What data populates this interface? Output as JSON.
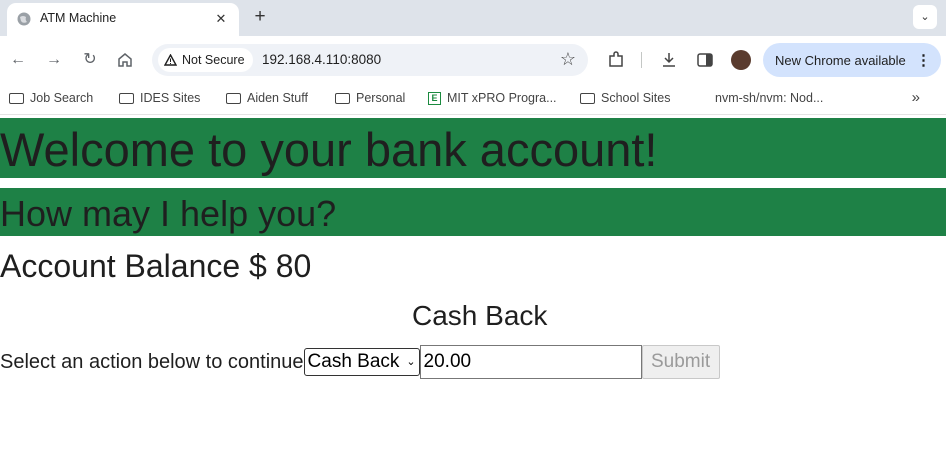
{
  "browser": {
    "tab_title": "ATM Machine",
    "security_label": "Not Secure",
    "url": "192.168.4.110:8080",
    "update_label": "New Chrome available",
    "bookmarks": [
      "Job Search",
      "IDES Sites",
      "Aiden Stuff",
      "Personal",
      "MIT xPRO Progra...",
      "School Sites",
      "nvm-sh/nvm: Nod..."
    ]
  },
  "page": {
    "welcome": "Welcome to your bank account!",
    "help": "How may I help you?",
    "balance": "Account Balance $ 80",
    "section_title": "Cash Back",
    "prompt": "Select an action below to continue",
    "action_selected": "Cash Back",
    "amount_value": "20.00",
    "submit_label": "Submit"
  },
  "colors": {
    "banner": "#1e8146"
  }
}
